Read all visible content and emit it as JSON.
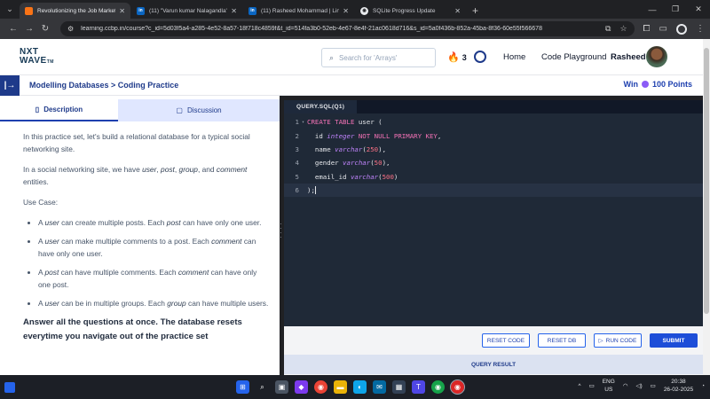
{
  "browser": {
    "tabs": [
      {
        "title": "Revolutionizing the Job Market",
        "active": true,
        "favicon": "orange"
      },
      {
        "title": "(11) \"Varun kumar Nalagandla\"",
        "active": false,
        "favicon": "li"
      },
      {
        "title": "(11) Rasheed Mohammad | Link",
        "active": false,
        "favicon": "li"
      },
      {
        "title": "SQLite Progress Update",
        "active": false,
        "favicon": "chrome"
      }
    ],
    "url": "learning.ccbp.in/course?c_id=5d03f5a4-a285-4e52-8a57-18f718c4859f&t_id=514fa3b0-52eb-4e67-8e4f-21ac0618d716&s_id=5a0f436b-852a-45ba-8f36-60e55f566678"
  },
  "header": {
    "logo_line1": "NXT",
    "logo_line2": "WAVE",
    "logo_tm": "TM",
    "search_placeholder": "Search for 'Arrays'",
    "streak_count": "3",
    "links": [
      "Home",
      "Code Playground",
      "Rasheed"
    ]
  },
  "breadcrumb": "Modelling Databases > Coding Practice",
  "win_prefix": "Win",
  "win_points": "100 Points",
  "left_tabs": [
    "Description",
    "Discussion"
  ],
  "description": {
    "p1": "In this practice set, let's build a relational database for a typical social networking site.",
    "p2_pre": "In a social networking site, we have ",
    "p2_terms": [
      "user",
      "post",
      "group",
      "comment"
    ],
    "p2_sep1": ", ",
    "p2_sep2": ", ",
    "p2_sep3": ", and ",
    "p2_post": " entities.",
    "use_case": "Use Case:",
    "bullets": [
      {
        "pre": "A ",
        "t1": "user",
        "mid": " can create multiple posts. Each ",
        "t2": "post",
        "post": " can have only one user."
      },
      {
        "pre": "A ",
        "t1": "user",
        "mid": " can make multiple comments to a post. Each ",
        "t2": "comment",
        "post": " can have only one user."
      },
      {
        "pre": "A ",
        "t1": "post",
        "mid": " can have multiple comments. Each ",
        "t2": "comment",
        "post": " can have only one post."
      },
      {
        "pre": "A ",
        "t1": "user",
        "mid": " can be in multiple groups. Each ",
        "t2": "group",
        "post": " can have multiple users."
      }
    ],
    "note": "Answer all the questions at once. The database resets everytime you navigate out of the practice set"
  },
  "editor": {
    "tab": "QUERY.SQL(Q1)",
    "line_numbers": [
      "1",
      "2",
      "3",
      "4",
      "5",
      "6"
    ],
    "line1": {
      "kw": "CREATE TABLE",
      "rest": " user ("
    },
    "line2": {
      "indent": "  id ",
      "ty": "integer",
      "kw": " NOT NULL PRIMARY KEY",
      "rest": ","
    },
    "line3": {
      "indent": "  name ",
      "ty": "varchar",
      "open": "(",
      "num": "250",
      "close": "),"
    },
    "line4": {
      "indent": "  gender ",
      "ty": "varchar",
      "open": "(",
      "num": "50",
      "close": "),"
    },
    "line5": {
      "indent": "  email_id ",
      "ty": "varchar",
      "open": "(",
      "num": "500",
      "close": ")"
    },
    "line6": ");"
  },
  "actions": {
    "reset_code": "RESET CODE",
    "reset_db": "RESET DB",
    "run_code": "RUN CODE",
    "submit": "SUBMIT",
    "query_result": "QUERY RESULT"
  },
  "taskbar": {
    "lang1": "ENG",
    "lang2": "US",
    "time": "20:38",
    "date": "26-02-2025"
  },
  "colors": {
    "brand": "#1e3a8a",
    "accent": "#1d4ed8",
    "editor_bg": "#1f2937"
  }
}
